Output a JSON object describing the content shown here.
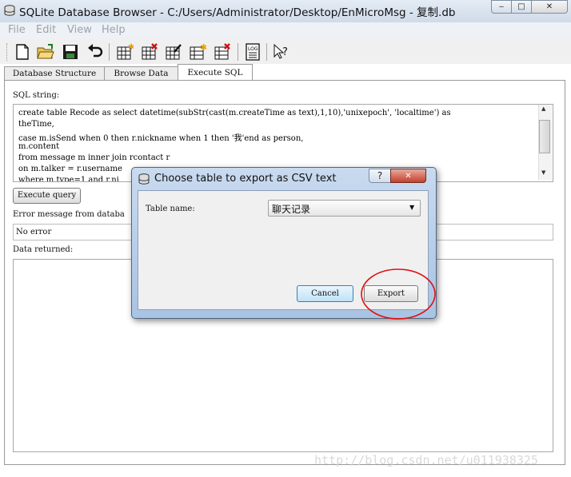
{
  "window": {
    "title": "SQLite Database Browser - C:/Users/Administrator/Desktop/EnMicroMsg - 复制.db",
    "controls": {
      "minimize": "‒",
      "maximize": "□",
      "close": "✕"
    }
  },
  "menu": [
    "File",
    "Edit",
    "View",
    "Help"
  ],
  "toolbar": {
    "icons": [
      "new-database-icon",
      "open-database-icon",
      "save-icon",
      "undo-icon",
      "create-table-icon",
      "delete-table-icon",
      "modify-table-icon",
      "create-index-icon",
      "delete-index-icon",
      "log-icon",
      "whats-this-icon"
    ],
    "log_label": "LOG"
  },
  "tabs": [
    "Database Structure",
    "Browse Data",
    "Execute SQL"
  ],
  "execute_sql": {
    "sql_label": "SQL string:",
    "sql_lines": [
      "create table Recode as select datetime(subStr(cast(m.createTime as text),1,10),'unixepoch', 'localtime') as",
      " theTime,",
      "case m.isSend when 0 then r.nickname when 1 then '我'end as person,",
      "m.content",
      "from message m inner join rcontact r",
      "on m.talker = r.username",
      "where m.type=1 and r.ni"
    ],
    "execute_button": "Execute query",
    "error_label": "Error message from databa",
    "error_value": "No error",
    "data_label": "Data returned:"
  },
  "dialog": {
    "title": "Choose table to export as CSV text",
    "help": "?",
    "close": "✕",
    "table_name_label": "Table name:",
    "table_name_value": "聊天记录",
    "cancel_button": "Cancel",
    "export_button": "Export"
  },
  "watermark": "http://blog.csdn.net/u011938325",
  "colors": {
    "annotation_circle": "#e01010",
    "titlebar": "#d5e1ee",
    "dialog_frame": "#b4cce8"
  }
}
